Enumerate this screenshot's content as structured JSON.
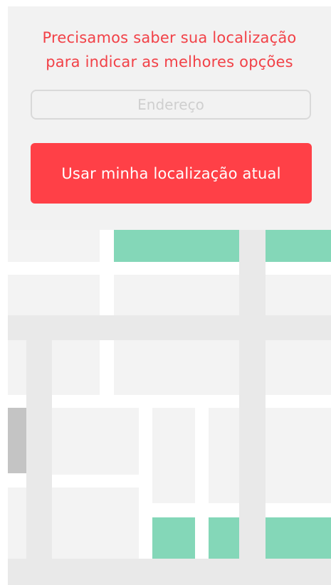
{
  "location_prompt": {
    "line1": "Precisamos saber sua localização",
    "line2": "para indicar as melhores opções"
  },
  "address_input": {
    "placeholder": "Endereço",
    "value": ""
  },
  "locate_button": {
    "label": "Usar minha localização atual"
  },
  "colors": {
    "accent": "#ff4047",
    "prompt_text": "#f24147",
    "panel_background": "#f2f2f2",
    "map_park": "#84d7b8",
    "map_road": "#e9e9e9",
    "map_block": "#f3f3f3"
  }
}
